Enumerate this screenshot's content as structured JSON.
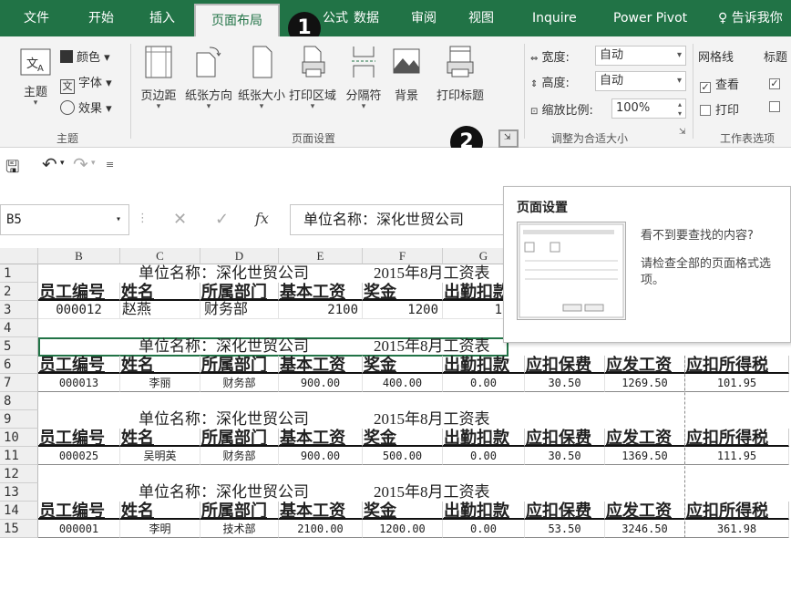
{
  "tabs": [
    "文件",
    "开始",
    "插入",
    "页面布局",
    "公式",
    "数据",
    "审阅",
    "视图",
    "Inquire",
    "Power Pivot"
  ],
  "tell_me": "告诉我你",
  "callouts": [
    "1",
    "2"
  ],
  "ribbon": {
    "theme": {
      "main": "主题",
      "colors": "颜色",
      "fonts": "字体",
      "effects": "效果",
      "group": "主题"
    },
    "page_setup": {
      "buttons": [
        "页边距",
        "纸张方向",
        "纸张大小",
        "打印区域",
        "分隔符",
        "背景",
        "打印标题"
      ],
      "group": "页面设置"
    },
    "scale": {
      "width_label": "宽度:",
      "width_value": "自动",
      "height_label": "高度:",
      "height_value": "自动",
      "scale_label": "缩放比例:",
      "scale_value": "100%",
      "group": "调整为合适大小"
    },
    "sheet_options": {
      "gridlines": "网格线",
      "headings": "标题",
      "view": "查看",
      "print": "打印",
      "group": "工作表选项"
    }
  },
  "name_box": "B5",
  "formula": "单位名称：深化世贸公司",
  "fx_symbol": "fx",
  "tooltip": {
    "title": "页面设置",
    "line1": "看不到要查找的内容?",
    "line2": "请检查全部的页面格式选项。"
  },
  "columns": [
    "B",
    "C",
    "D",
    "E",
    "F",
    "G"
  ],
  "rows": [
    "1",
    "2",
    "3",
    "4",
    "5",
    "6",
    "7",
    "8",
    "9",
    "10",
    "11",
    "12",
    "13",
    "14",
    "15"
  ],
  "sheet": {
    "title_company": "单位名称：深化世贸公司",
    "title_month": "2015年8月工资表",
    "headers": [
      "员工编号",
      "姓名",
      "所属部门",
      "基本工资",
      "奖金",
      "出勤扣款",
      "应扣保费",
      "应发工资",
      "应扣所得税"
    ],
    "row3": [
      "000012",
      "赵燕",
      "财务部",
      "2100",
      "1200",
      "1"
    ],
    "row7": [
      "000013",
      "李丽",
      "财务部",
      "900.00",
      "400.00",
      "0.00",
      "30.50",
      "1269.50",
      "101.95"
    ],
    "row11": [
      "000025",
      "吴明英",
      "财务部",
      "900.00",
      "500.00",
      "0.00",
      "30.50",
      "1369.50",
      "111.95"
    ],
    "row15": [
      "000001",
      "李明",
      "技术部",
      "2100.00",
      "1200.00",
      "0.00",
      "53.50",
      "3246.50",
      "361.98"
    ]
  }
}
